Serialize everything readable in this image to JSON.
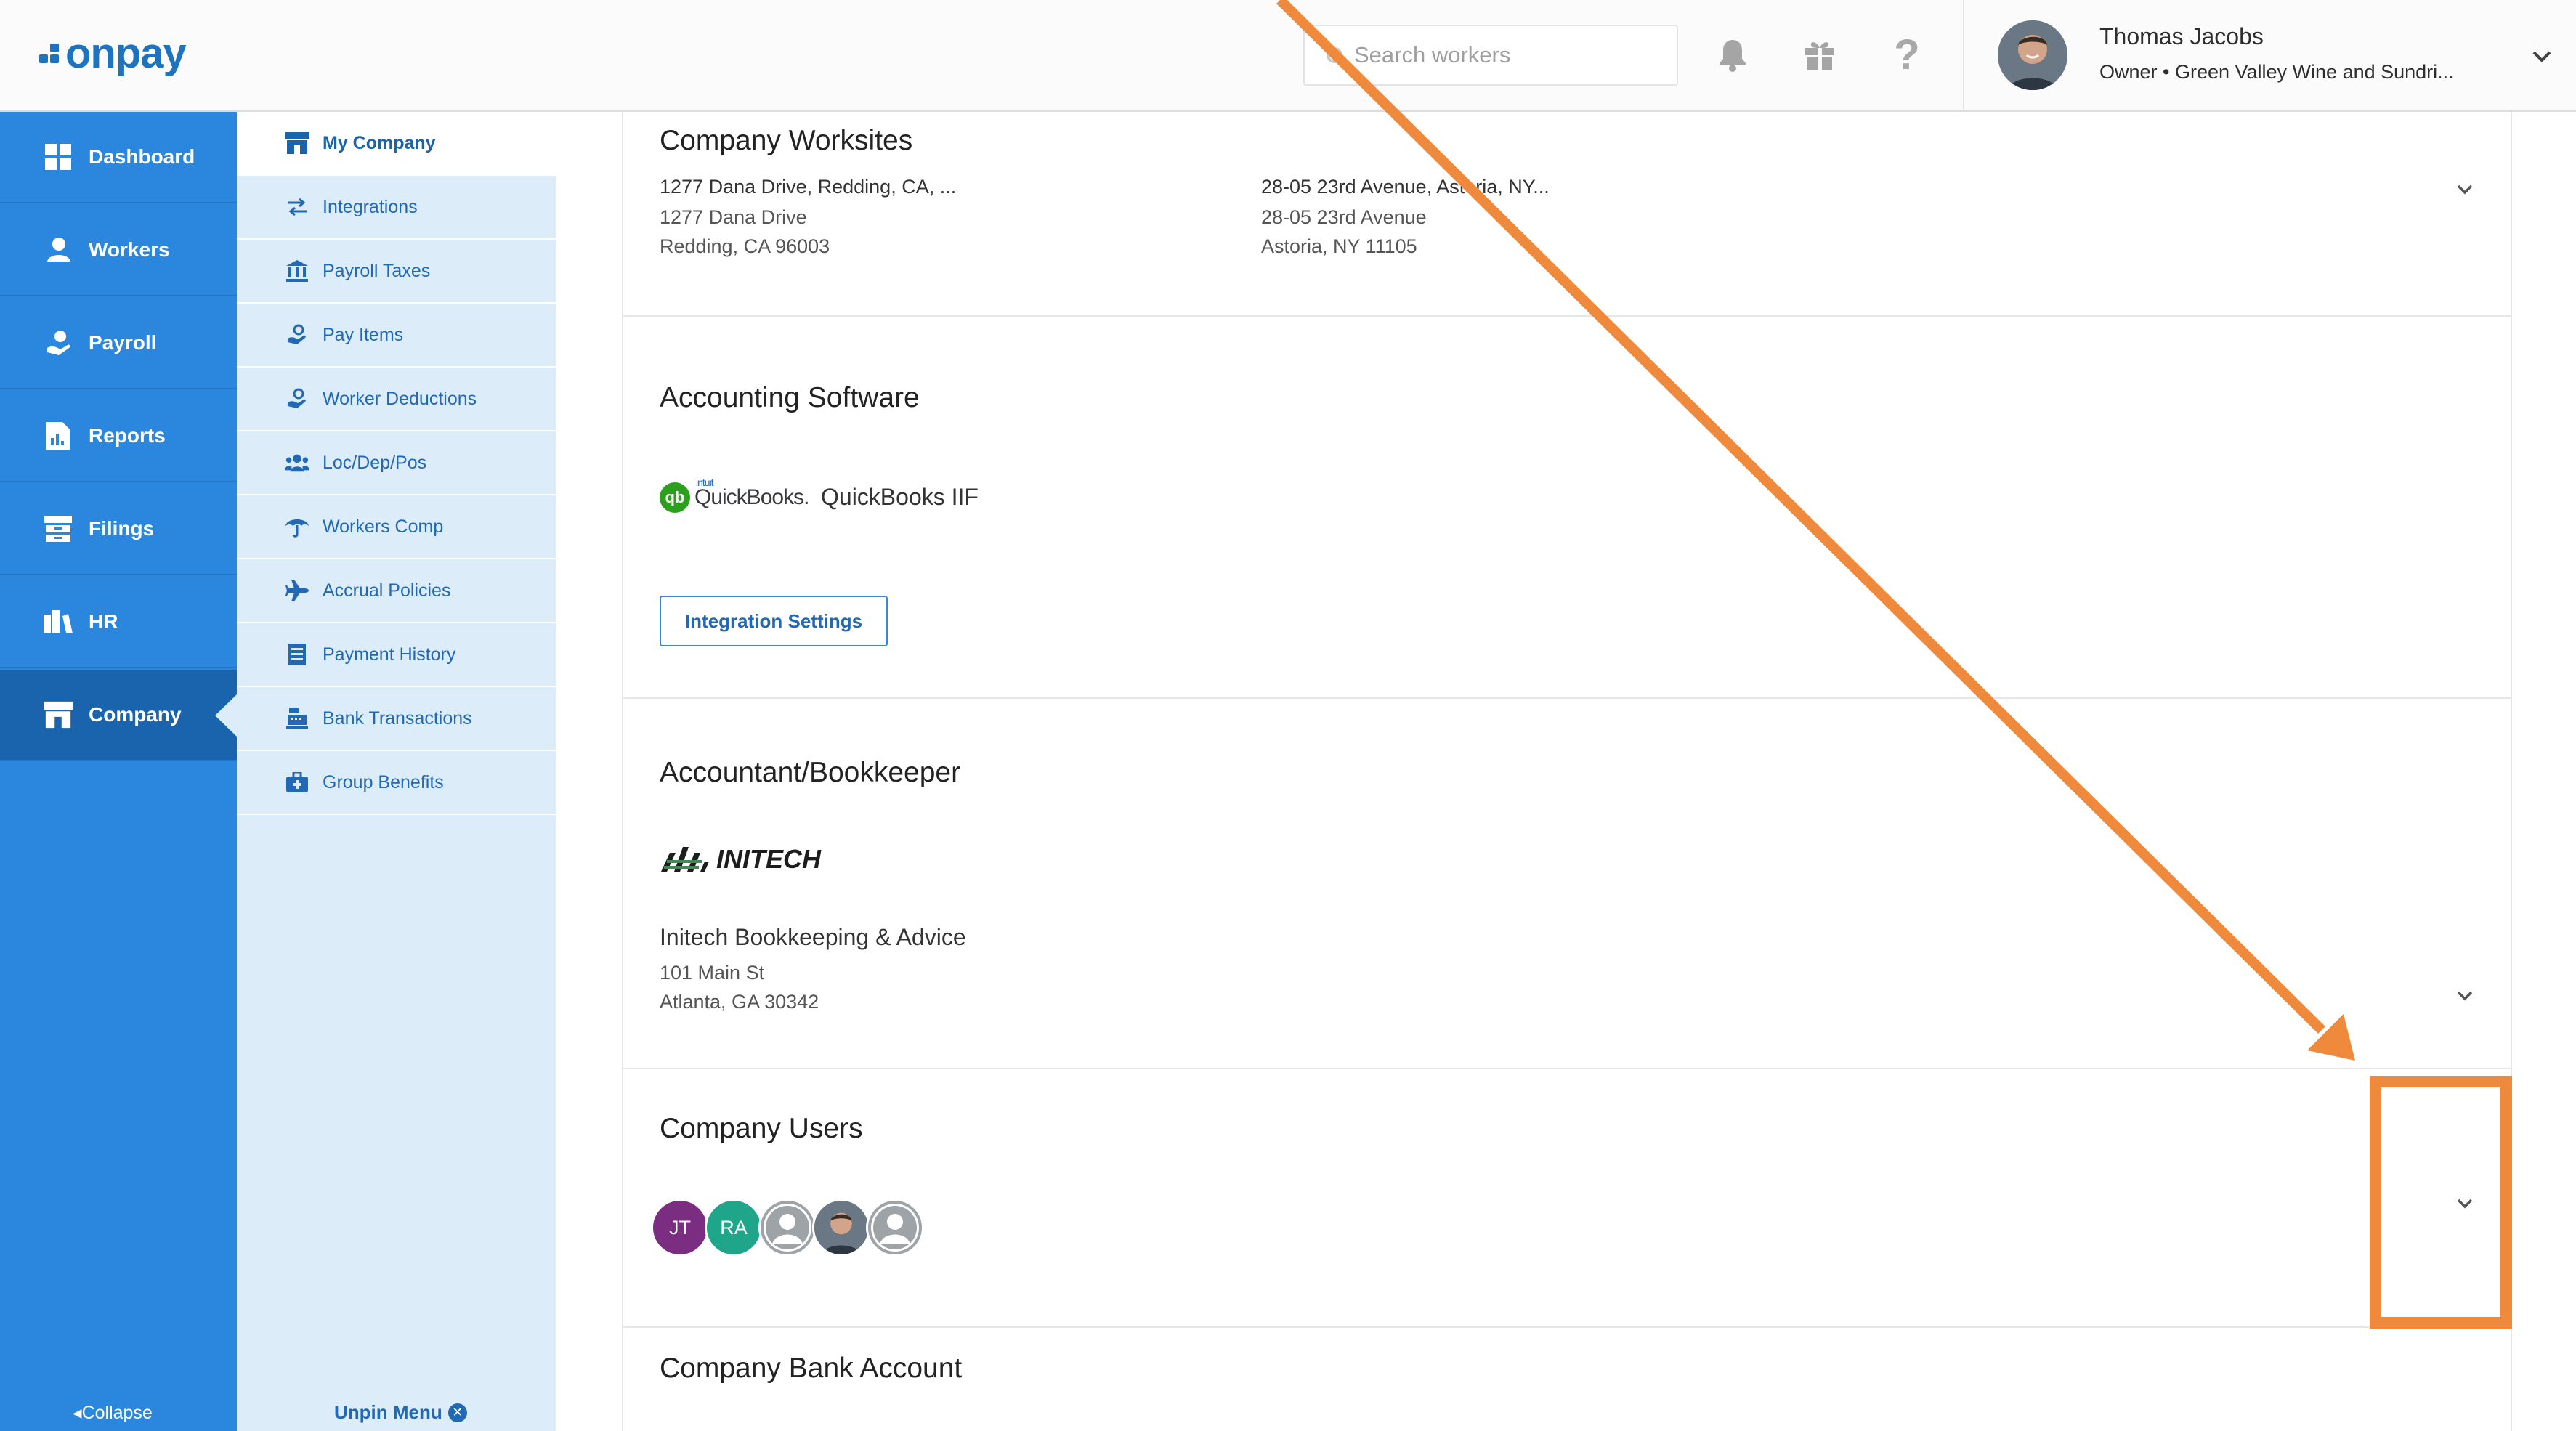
{
  "header": {
    "logo_text": "onpay",
    "search_placeholder": "Search workers",
    "user_name": "Thomas Jacobs",
    "user_role": "Owner • Green Valley Wine and Sundri..."
  },
  "leftnav": {
    "items": [
      {
        "label": "Dashboard",
        "icon": "dashboard-icon"
      },
      {
        "label": "Workers",
        "icon": "workers-icon"
      },
      {
        "label": "Payroll",
        "icon": "payroll-icon"
      },
      {
        "label": "Reports",
        "icon": "reports-icon"
      },
      {
        "label": "Filings",
        "icon": "filings-icon"
      },
      {
        "label": "HR",
        "icon": "hr-icon"
      },
      {
        "label": "Company",
        "icon": "company-icon",
        "active": true
      }
    ],
    "collapse_label": "Collapse"
  },
  "subnav": {
    "items": [
      {
        "label": "My Company",
        "icon": "store-icon",
        "active": true
      },
      {
        "label": "Integrations",
        "icon": "arrows-icon"
      },
      {
        "label": "Payroll Taxes",
        "icon": "bank-icon"
      },
      {
        "label": "Pay Items",
        "icon": "hand-money-icon"
      },
      {
        "label": "Worker Deductions",
        "icon": "hand-money-icon"
      },
      {
        "label": "Loc/Dep/Pos",
        "icon": "group-icon"
      },
      {
        "label": "Workers Comp",
        "icon": "umbrella-icon"
      },
      {
        "label": "Accrual Policies",
        "icon": "plane-icon"
      },
      {
        "label": "Payment History",
        "icon": "list-icon"
      },
      {
        "label": "Bank Transactions",
        "icon": "register-icon"
      },
      {
        "label": "Group Benefits",
        "icon": "medkit-icon"
      }
    ],
    "unpin_label": "Unpin Menu"
  },
  "worksites": {
    "title": "Company Worksites",
    "sites": [
      {
        "name": "1277 Dana Drive, Redding, CA, ...",
        "line1": "1277 Dana Drive",
        "line2": "Redding, CA 96003"
      },
      {
        "name": "28-05 23rd Avenue, Astoria, NY...",
        "line1": "28-05 23rd Avenue",
        "line2": "Astoria, NY 11105"
      }
    ]
  },
  "accounting": {
    "title": "Accounting Software",
    "logo_intuit": "intuit",
    "logo_word": "QuickBooks.",
    "logo_badge": "qb",
    "software_name": "QuickBooks IIF",
    "button_label": "Integration Settings"
  },
  "accountant": {
    "title": "Accountant/Bookkeeper",
    "logo_text": "INITECH",
    "name": "Initech Bookkeeping & Advice",
    "line1": "101 Main St",
    "line2": "Atlanta, GA 30342"
  },
  "users": {
    "title": "Company Users",
    "avatars": [
      {
        "initials": "JT",
        "color": "#7b2d82"
      },
      {
        "initials": "RA",
        "color": "#1fa68a"
      },
      {
        "initials": "",
        "color": "#9ea3a8",
        "icon": "person-icon"
      },
      {
        "initials": "",
        "color": "#5d6b78",
        "icon": "photo-avatar"
      },
      {
        "initials": "",
        "color": "#9ea3a8",
        "icon": "person-icon"
      }
    ]
  },
  "bank": {
    "title": "Company Bank Account"
  },
  "colors": {
    "primary": "#2a87dd",
    "primary_dark": "#1a63ad",
    "subnav_bg": "#dcecf9",
    "annotation": "#ef8a3c"
  }
}
